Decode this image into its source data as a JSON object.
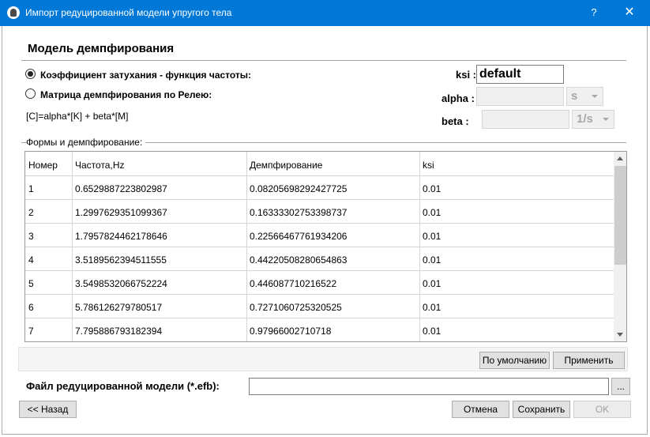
{
  "window": {
    "title": "Импорт редуцированной модели упругого тела",
    "help_label": "?",
    "close_label": "✕"
  },
  "damping": {
    "section_title": "Модель демпфирования",
    "option_freq_label": "Коэффициент затухания - функция частоты:",
    "option_rayleigh_label": "Матрица демпфирования по Релею:",
    "selected_option": "freq",
    "formula": "[C]=alpha*[K] + beta*[M]",
    "ksi_label": "ksi :",
    "ksi_value": "default",
    "alpha_label": "alpha :",
    "alpha_value": "",
    "alpha_unit": "s",
    "beta_label": "beta :",
    "beta_value": "",
    "beta_unit": "1/s"
  },
  "modes": {
    "group_label": "Формы и демпфирование:",
    "columns": [
      "Номер",
      "Частота,Hz",
      "Демпфирование",
      "ksi"
    ],
    "rows": [
      [
        "1",
        "0.6529887223802987",
        "0.08205698292427725",
        "0.01"
      ],
      [
        "2",
        "1.2997629351099367",
        "0.16333302753398737",
        "0.01"
      ],
      [
        "3",
        "1.7957824462178646",
        "0.22566467761934206",
        "0.01"
      ],
      [
        "4",
        "3.5189562394511555",
        "0.44220508280654863",
        "0.01"
      ],
      [
        "5",
        "3.5498532066752224",
        "0.446087710216522",
        "0.01"
      ],
      [
        "6",
        "5.786126279780517",
        "0.7271060725320525",
        "0.01"
      ],
      [
        "7",
        "7.795886793182394",
        "0.97966002710718",
        "0.01"
      ]
    ]
  },
  "buttons": {
    "defaults_label": "По умолчанию",
    "apply_label": "Применить",
    "back_label": "<< Назад",
    "cancel_label": "Отмена",
    "save_label": "Сохранить",
    "ok_label": "OK",
    "browse_label": "..."
  },
  "file": {
    "label": "Файл редуцированной модели (*.efb):",
    "value": ""
  },
  "colors": {
    "titlebar": "#0078d7",
    "button_face": "#e1e1e1",
    "disabled_field": "#f0f0f0"
  }
}
